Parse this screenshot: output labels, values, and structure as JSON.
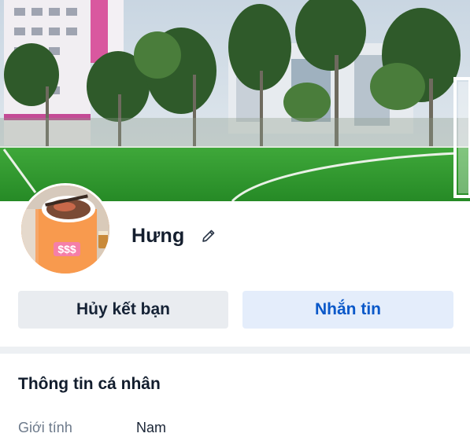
{
  "profile": {
    "name": "Hưng",
    "avatar_badge_text": "$$$"
  },
  "actions": {
    "unfriend_label": "Hủy kết bạn",
    "message_label": "Nhắn tin"
  },
  "personal_info": {
    "title": "Thông tin cá nhân",
    "rows": [
      {
        "label": "Giới tính",
        "value": "Nam"
      }
    ]
  },
  "colors": {
    "message_button_bg": "#e4edfb",
    "message_button_text": "#0a58c9",
    "unfriend_button_bg": "#e9ecf0"
  },
  "icons": {
    "edit": "pencil-icon"
  }
}
